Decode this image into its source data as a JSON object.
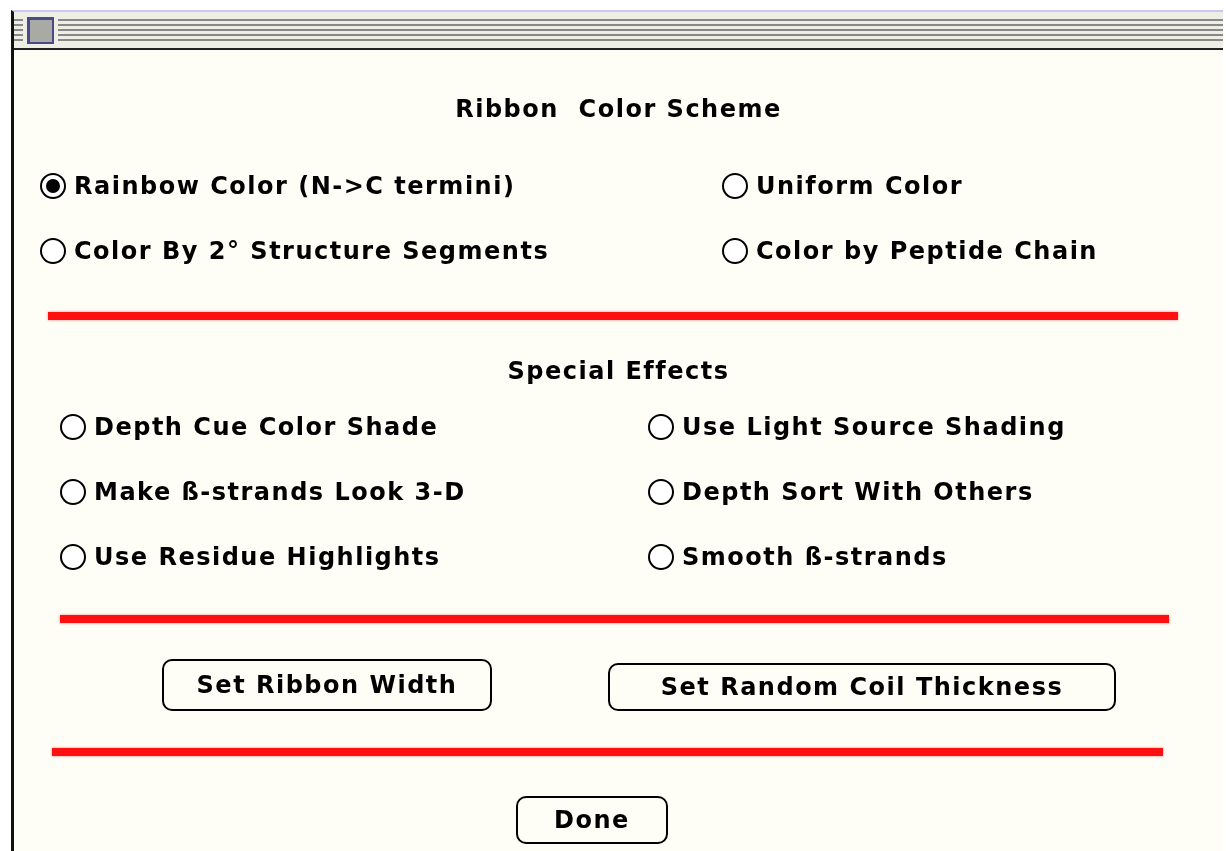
{
  "sections": [
    {
      "title": "Ribbon  Color Scheme",
      "kind": "scheme",
      "options": [
        {
          "label": "Rainbow Color (N->C termini)",
          "selected": true
        },
        {
          "label": "Uniform Color",
          "selected": false
        },
        {
          "label": "Color By 2° Structure Segments",
          "selected": false
        },
        {
          "label": "Color by Peptide Chain",
          "selected": false
        }
      ]
    },
    {
      "title": "Special Effects",
      "kind": "effects",
      "options": [
        {
          "label": "Depth Cue Color Shade",
          "selected": false
        },
        {
          "label": "Use Light Source Shading",
          "selected": false
        },
        {
          "label": "Make ß-strands Look 3-D",
          "selected": false
        },
        {
          "label": "Depth Sort With Others",
          "selected": false
        },
        {
          "label": "Use Residue Highlights",
          "selected": false
        },
        {
          "label": "Smooth ß-strands",
          "selected": false
        }
      ]
    }
  ],
  "buttons": [
    "Set Ribbon Width",
    "Set Random Coil Thickness"
  ],
  "done_button": "Done"
}
